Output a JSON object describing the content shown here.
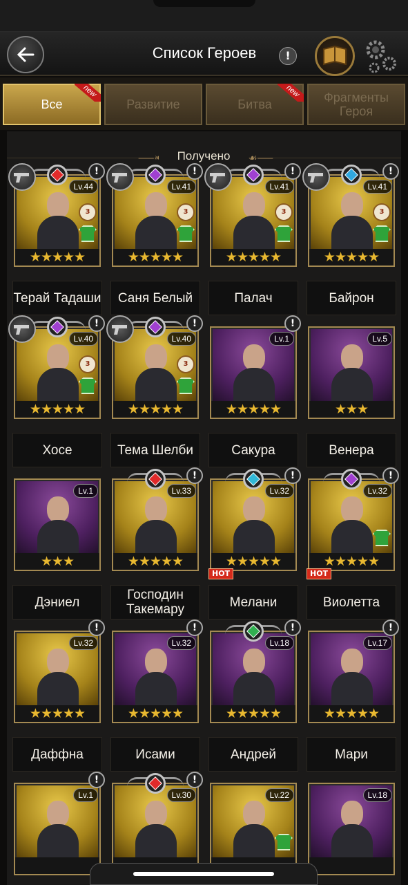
{
  "header": {
    "title": "Список Героев",
    "info_label": "!"
  },
  "tabs": [
    {
      "label": "Все",
      "active": true,
      "new": true
    },
    {
      "label": "Развитие",
      "active": false,
      "new": false
    },
    {
      "label": "Битва",
      "active": false,
      "new": true
    },
    {
      "label": "Фрагменты Героя",
      "active": false,
      "new": false
    }
  ],
  "new_label": "new",
  "section_label": "Получено",
  "heroes": [
    {
      "name": "Терай Тадаши",
      "level": "Lv.44",
      "stars": "★★★★★",
      "bg": "gold",
      "weapon": true,
      "gem": "#e02a2a",
      "badge": true,
      "shirt": true,
      "hot": false,
      "excl": true
    },
    {
      "name": "Саня Белый",
      "level": "Lv.41",
      "stars": "★★★★★",
      "bg": "gold",
      "weapon": true,
      "gem": "#a040d0",
      "badge": true,
      "shirt": true,
      "hot": false,
      "excl": true
    },
    {
      "name": "Палач",
      "level": "Lv.41",
      "stars": "★★★★★",
      "bg": "gold",
      "weapon": true,
      "gem": "#a040d0",
      "badge": true,
      "shirt": true,
      "hot": false,
      "excl": true
    },
    {
      "name": "Байрон",
      "level": "Lv.41",
      "stars": "★★★★★",
      "bg": "gold",
      "weapon": true,
      "gem": "#30a8e0",
      "badge": true,
      "shirt": true,
      "hot": false,
      "excl": true
    },
    {
      "name": "Хосе",
      "level": "Lv.40",
      "stars": "★★★★★",
      "bg": "gold",
      "weapon": true,
      "gem": "#a040d0",
      "badge": true,
      "shirt": true,
      "hot": false,
      "excl": true
    },
    {
      "name": "Тема Шелби",
      "level": "Lv.40",
      "stars": "★★★★★",
      "bg": "gold",
      "weapon": true,
      "gem": "#a040d0",
      "badge": true,
      "shirt": true,
      "hot": false,
      "excl": true
    },
    {
      "name": "Сакура",
      "level": "Lv.1",
      "stars": "★★★★★",
      "bg": "purple",
      "weapon": false,
      "gem": "",
      "badge": false,
      "shirt": false,
      "hot": false,
      "excl": true
    },
    {
      "name": "Венера",
      "level": "Lv.5",
      "stars": "★★★",
      "bg": "purple",
      "weapon": false,
      "gem": "",
      "badge": false,
      "shirt": false,
      "hot": false,
      "excl": false
    },
    {
      "name": "Дэниел",
      "level": "Lv.1",
      "stars": "★★★",
      "bg": "purple",
      "weapon": false,
      "gem": "",
      "badge": false,
      "shirt": false,
      "hot": false,
      "excl": false
    },
    {
      "name": "Господин Такемару",
      "level": "Lv.33",
      "stars": "★★★★★",
      "bg": "gold",
      "weapon": false,
      "gem": "#e02a2a",
      "badge": false,
      "shirt": false,
      "hot": false,
      "excl": true
    },
    {
      "name": "Мелани",
      "level": "Lv.32",
      "stars": "★★★★★",
      "bg": "gold",
      "weapon": false,
      "gem": "#30b8d8",
      "badge": false,
      "shirt": false,
      "hot": true,
      "excl": true
    },
    {
      "name": "Виолетта",
      "level": "Lv.32",
      "stars": "★★★★★",
      "bg": "gold",
      "weapon": false,
      "gem": "#a040d0",
      "badge": false,
      "shirt": true,
      "hot": true,
      "excl": true
    },
    {
      "name": "Даффна",
      "level": "Lv.32",
      "stars": "★★★★★",
      "bg": "gold",
      "weapon": false,
      "gem": "",
      "badge": false,
      "shirt": false,
      "hot": false,
      "excl": true
    },
    {
      "name": "Исами",
      "level": "Lv.32",
      "stars": "★★★★★",
      "bg": "purple",
      "weapon": false,
      "gem": "",
      "badge": false,
      "shirt": false,
      "hot": false,
      "excl": true
    },
    {
      "name": "Андрей",
      "level": "Lv.18",
      "stars": "★★★★★",
      "bg": "purple",
      "weapon": false,
      "gem": "#30b050",
      "badge": false,
      "shirt": false,
      "hot": false,
      "excl": true
    },
    {
      "name": "Мари",
      "level": "Lv.17",
      "stars": "★★★★★",
      "bg": "purple",
      "weapon": false,
      "gem": "",
      "badge": false,
      "shirt": false,
      "hot": false,
      "excl": true
    },
    {
      "name": "",
      "level": "Lv.1",
      "stars": "",
      "bg": "gold",
      "weapon": false,
      "gem": "",
      "badge": false,
      "shirt": false,
      "hot": false,
      "excl": true
    },
    {
      "name": "",
      "level": "Lv.30",
      "stars": "",
      "bg": "gold",
      "weapon": false,
      "gem": "#e02a2a",
      "badge": false,
      "shirt": false,
      "hot": false,
      "excl": true
    },
    {
      "name": "",
      "level": "Lv.22",
      "stars": "",
      "bg": "gold",
      "weapon": false,
      "gem": "",
      "badge": false,
      "shirt": true,
      "hot": false,
      "excl": false
    },
    {
      "name": "",
      "level": "Lv.18",
      "stars": "",
      "bg": "purple",
      "weapon": false,
      "gem": "",
      "badge": false,
      "shirt": false,
      "hot": false,
      "excl": false
    }
  ],
  "hot_label": "HOT",
  "colors": {
    "accent_gold": "#c9a64c",
    "bg": "#1b1a19"
  }
}
